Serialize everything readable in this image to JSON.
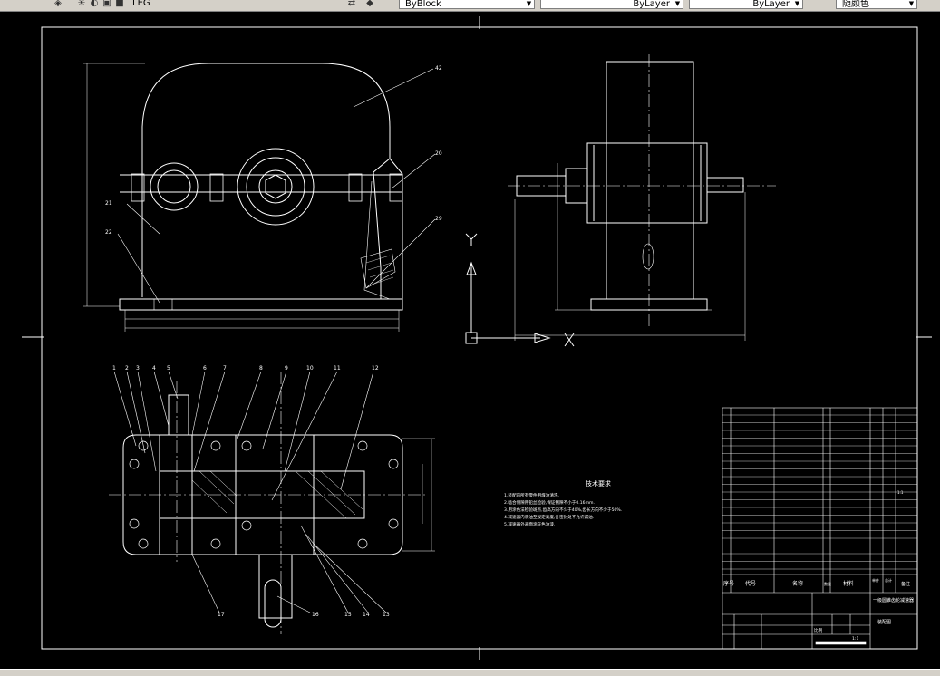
{
  "toolbar": {
    "layer_name": "LEG",
    "color_value": "ByBlock",
    "linetype_value": "ByLayer",
    "lineweight_value": "ByLayer",
    "plotstyle_value": "随颜色"
  },
  "drawing": {
    "top_labels": [
      "42",
      "20",
      "29",
      "21",
      "22"
    ],
    "bottom_labels": [
      "1",
      "2",
      "3",
      "4",
      "5",
      "6",
      "7",
      "8",
      "9",
      "10",
      "11",
      "12",
      "13",
      "14",
      "15",
      "16",
      "17"
    ],
    "tech_title": "技术要求",
    "tech_lines": [
      "1.装配前所有零件用煤油清洗.",
      "2.啮合侧隙用铅丝检验,保证侧隙不小于0.16mm.",
      "3.用涂色法检验斑点,齿高方向不少于40%,齿长方向不少于50%.",
      "4.减速器内装油至规定高度,各密封处不允许漏油.",
      "5.减速器外表面涂灰色油漆."
    ],
    "ucs_y": "Y",
    "ucs_x": "X",
    "table_header": [
      "序号",
      "代号",
      "名称",
      "数量",
      "材料",
      "单件",
      "总计",
      "备注"
    ],
    "title_block": {
      "title": "一级圆锥齿轮减速器",
      "drawing_no": "装配图",
      "scale_label": "比例",
      "scale": "1:1",
      "sheet": "1:1"
    }
  }
}
